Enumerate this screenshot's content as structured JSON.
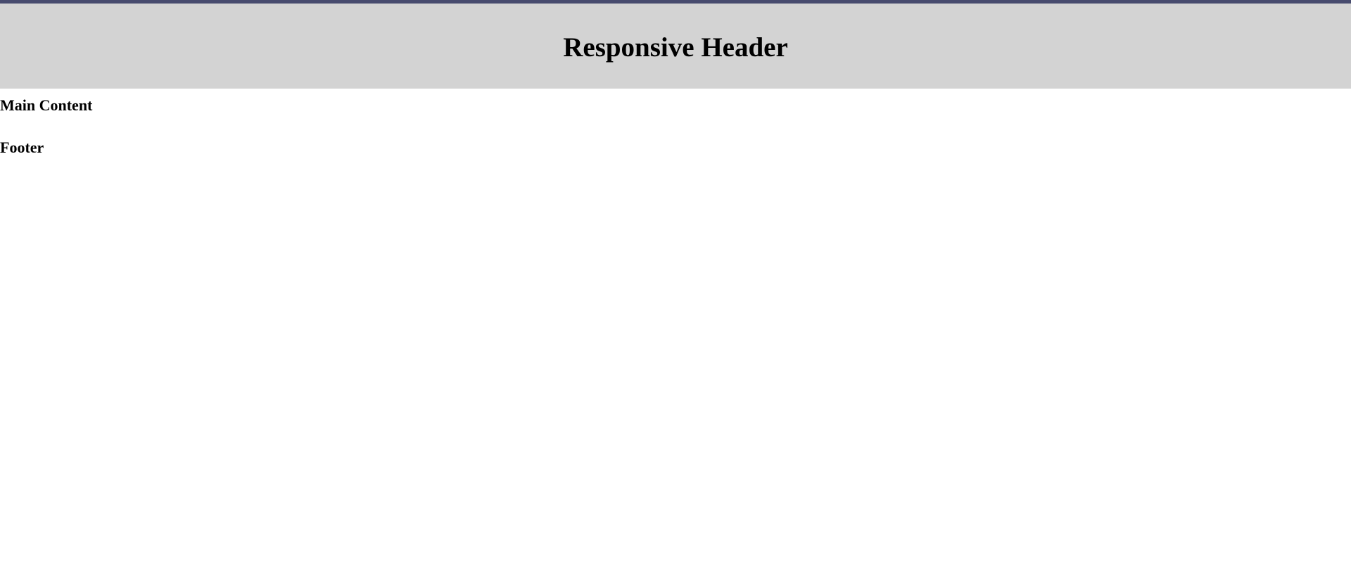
{
  "header": {
    "title": "Responsive Header"
  },
  "main": {
    "heading": "Main Content"
  },
  "footer": {
    "heading": "Footer"
  },
  "colors": {
    "top_strip": "#474b6e",
    "header_background": "#d3d3d3",
    "page_background": "#ffffff",
    "text": "#000000"
  }
}
